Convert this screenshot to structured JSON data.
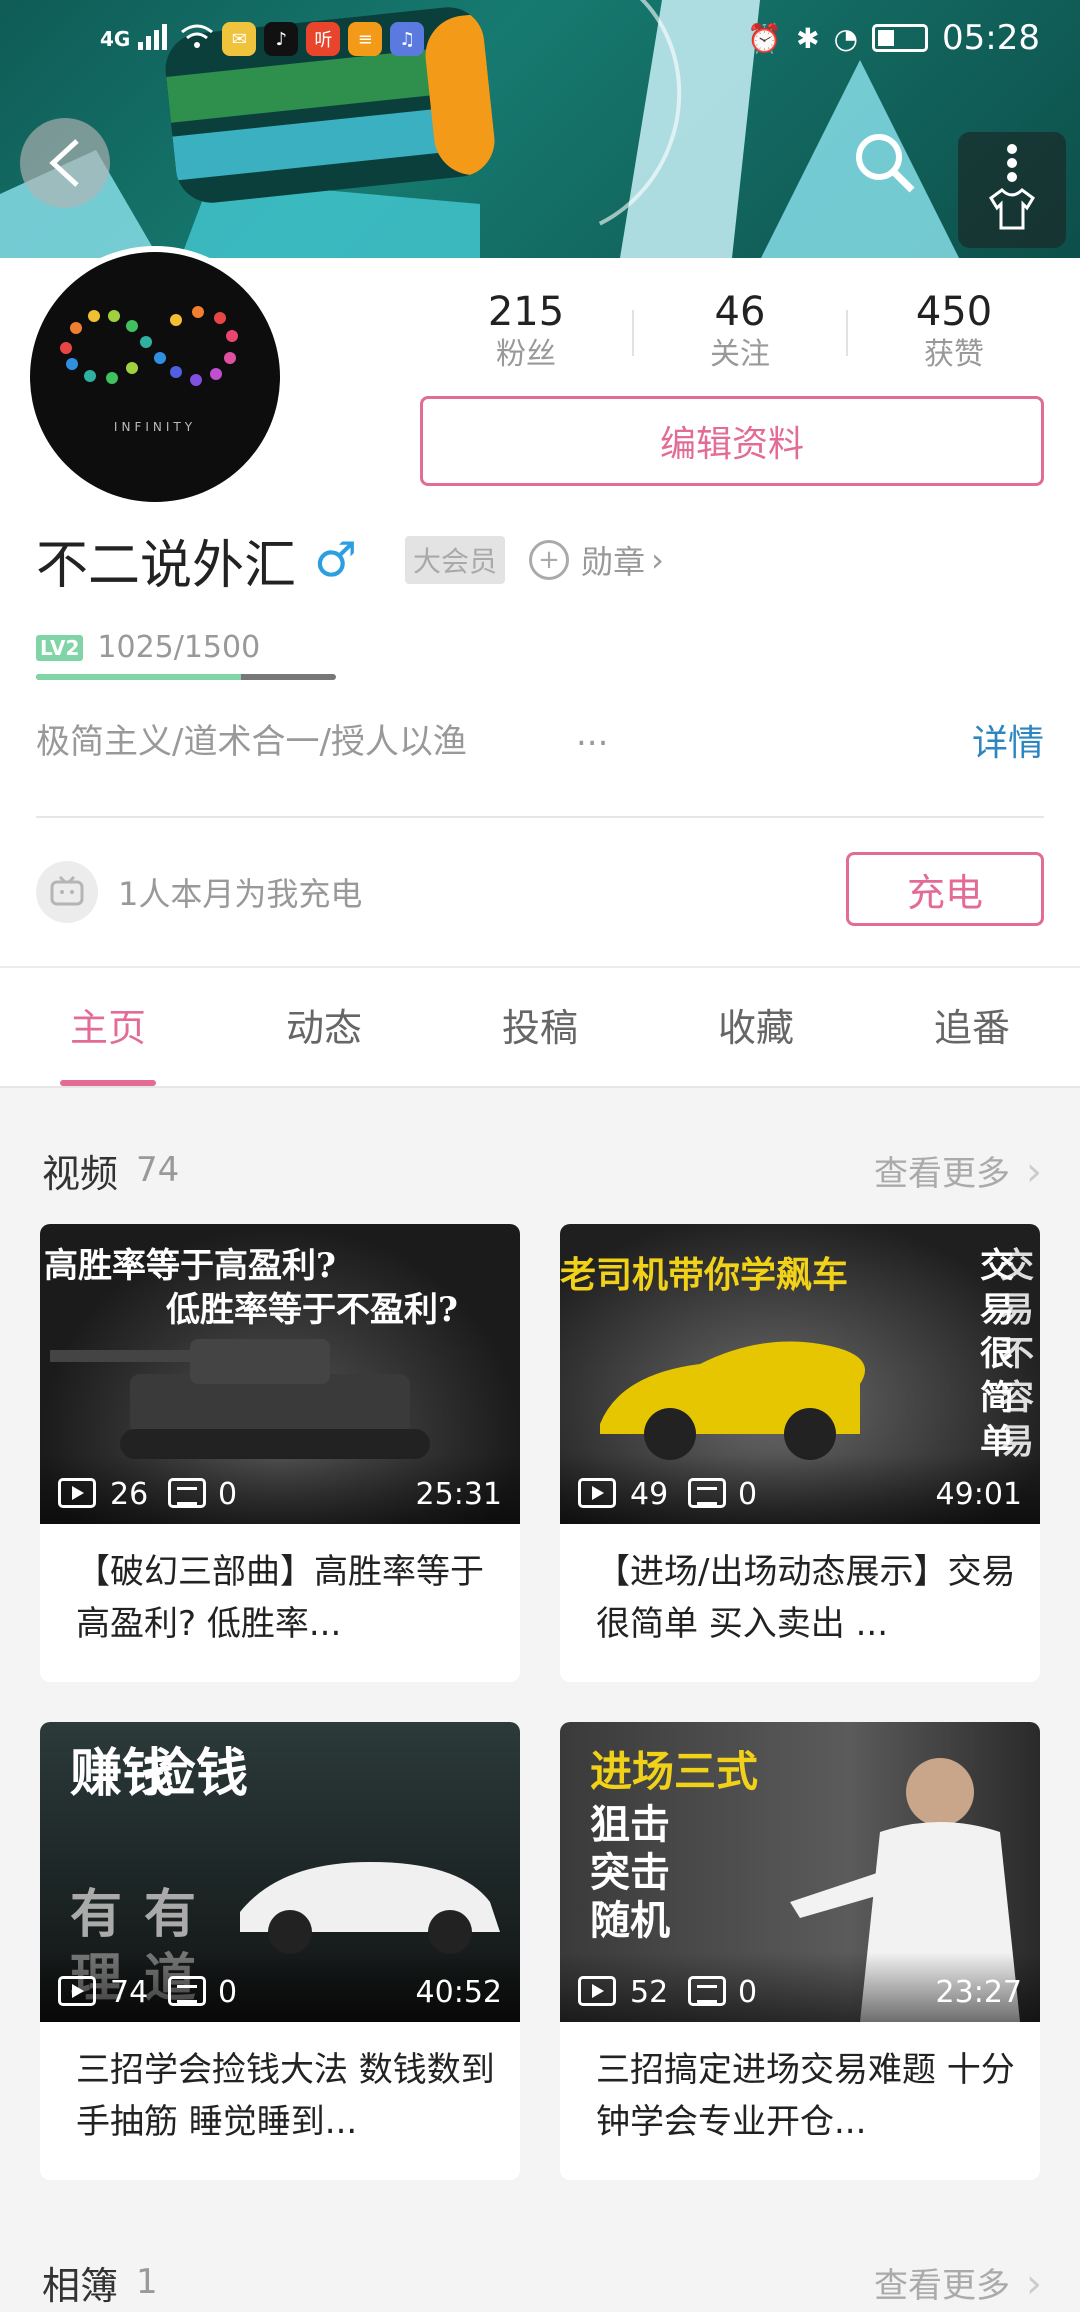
{
  "status_bar": {
    "time": "05:28",
    "network": "4G",
    "apps": [
      {
        "name": "mail-app-icon",
        "color": "#f0c33c"
      },
      {
        "name": "tiktok-app-icon",
        "color": "#111111"
      },
      {
        "name": "listen-app-icon",
        "color": "#e8452c",
        "label": "听"
      },
      {
        "name": "doc-app-icon",
        "color": "#f39b18"
      },
      {
        "name": "music-app-icon",
        "color": "#5a7ae0"
      }
    ]
  },
  "profile": {
    "avatar_brand": "INFINITY",
    "stats": [
      {
        "value": "215",
        "label": "粉丝"
      },
      {
        "value": "46",
        "label": "关注"
      },
      {
        "value": "450",
        "label": "获赞"
      }
    ],
    "edit_label": "编辑资料",
    "name": "不二说外汇",
    "gender_symbol": "♂",
    "vip_label": "大会员",
    "medal_label": "勋章",
    "level_badge": "LV2",
    "level_progress": "1025/1500",
    "level_fraction": 0.683,
    "bio": "极简主义/道术合一/授人以渔",
    "bio_ellipsis": "...",
    "detail_label": "详情",
    "charge_text": "1人本月为我充电",
    "charge_button": "充电"
  },
  "tabs": [
    {
      "label": "主页",
      "active": true
    },
    {
      "label": "动态",
      "active": false
    },
    {
      "label": "投稿",
      "active": false
    },
    {
      "label": "收藏",
      "active": false
    },
    {
      "label": "追番",
      "active": false
    }
  ],
  "videos_section": {
    "title": "视频",
    "count": "74",
    "more_label": "查看更多",
    "items": [
      {
        "thumb_lines": [
          "高胜率等于高盈利?",
          "低胜率等于不盈利?"
        ],
        "plays": "26",
        "danmaku": "0",
        "duration": "25:31",
        "title": "【破幻三部曲】高胜率等于高盈利? 低胜率..."
      },
      {
        "thumb_lines": [
          "老司机带你学飙车",
          "交易很简单",
          "交易不容易"
        ],
        "plays": "49",
        "danmaku": "0",
        "duration": "49:01",
        "title": "【进场/出场动态展示】交易很简单 买入卖出 ..."
      },
      {
        "thumb_lines": [
          "赚钱",
          "捡钱",
          "有",
          "有",
          "理",
          "道"
        ],
        "plays": "74",
        "danmaku": "0",
        "duration": "40:52",
        "title": "三招学会捡钱大法 数钱数到手抽筋 睡觉睡到..."
      },
      {
        "thumb_lines": [
          "进场三式",
          "狙击",
          "突击",
          "随机"
        ],
        "plays": "52",
        "danmaku": "0",
        "duration": "23:27",
        "title": "三招搞定进场交易难题 十分钟学会专业开仓..."
      }
    ]
  },
  "album_section": {
    "title": "相簿",
    "count": "1",
    "more_label": "查看更多"
  },
  "colors": {
    "accent_pink": "#e36c97",
    "link_blue": "#2e86c1",
    "level_green": "#80d4a5",
    "gender_blue": "#2b9fe0"
  }
}
